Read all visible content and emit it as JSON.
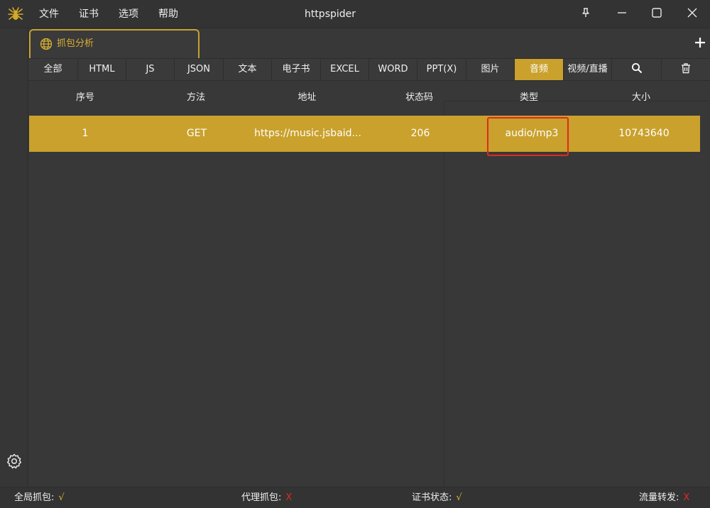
{
  "app": {
    "title": "httpspider",
    "menu": [
      "文件",
      "证书",
      "选项",
      "帮助"
    ]
  },
  "tab": {
    "label": "抓包分析"
  },
  "filters": {
    "items": [
      "全部",
      "HTML",
      "JS",
      "JSON",
      "文本",
      "电子书",
      "EXCEL",
      "WORD",
      "PPT(X)",
      "图片",
      "音频",
      "视频/直播"
    ],
    "active": "音频"
  },
  "table": {
    "columns": [
      "序号",
      "方法",
      "地址",
      "状态码",
      "类型",
      "大小"
    ],
    "rows": [
      {
        "index": "1",
        "method": "GET",
        "url": "https://music.jsbaid...",
        "status": "206",
        "type": "audio/mp3",
        "size": "10743640"
      }
    ]
  },
  "status": {
    "global_capture_label": "全局抓包:",
    "global_capture_value": "√",
    "proxy_capture_label": "代理抓包:",
    "proxy_capture_value": "X",
    "cert_status_label": "证书状态:",
    "cert_status_value": "√",
    "traffic_forward_label": "流量转发:",
    "traffic_forward_value": "X"
  },
  "colors": {
    "accent": "#c9a12c",
    "ok": "#e0b232",
    "error": "#e02a1f"
  },
  "icons": [
    "spider-icon",
    "pin-icon",
    "minimize-icon",
    "maximize-icon",
    "close-icon",
    "globe-icon",
    "plus-icon",
    "search-icon",
    "trash-icon",
    "gear-icon"
  ]
}
